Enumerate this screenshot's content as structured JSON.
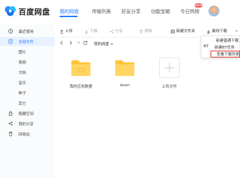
{
  "header": {
    "app_title": "百度网盘",
    "nav": [
      "我的网盘",
      "传输列表",
      "好友分享",
      "功能宝箱",
      "今日热榜"
    ],
    "badge": "NEW",
    "accent_color": "#1f7cff"
  },
  "sidebar": {
    "items": [
      {
        "label": "最近使用",
        "icon": "clock-icon"
      },
      {
        "label": "全部文件",
        "icon": "file-icon",
        "active": true
      },
      {
        "label": "图片"
      },
      {
        "label": "视频"
      },
      {
        "label": "文档"
      },
      {
        "label": "音乐"
      },
      {
        "label": "种子"
      },
      {
        "label": "其它"
      },
      {
        "label": "隐藏空间",
        "icon": "lock-icon"
      },
      {
        "label": "我的分享",
        "icon": "share-icon"
      },
      {
        "label": "回收站",
        "icon": "trash-icon"
      }
    ]
  },
  "toolbar": {
    "upload": "上传",
    "download": "下载",
    "share": "分享",
    "delete": "删除",
    "new_folder": "新建文件夹",
    "offline_download": "离线下载"
  },
  "breadcrumb": {
    "path": "我的网盘 >"
  },
  "files": [
    {
      "name": "我的应用数据",
      "type": "folder"
    },
    {
      "name": "down",
      "type": "folder"
    },
    {
      "name": "上传文件",
      "type": "upload"
    }
  ],
  "dropdown": {
    "items": [
      {
        "prefix": "",
        "label": "新建普通下载"
      },
      {
        "prefix": "BT",
        "label": "新建BT任务"
      },
      {
        "prefix": "",
        "label": "查看下载列表"
      }
    ]
  },
  "colors": {
    "folder": "#ffc53d",
    "highlight_border": "#e0302a"
  }
}
